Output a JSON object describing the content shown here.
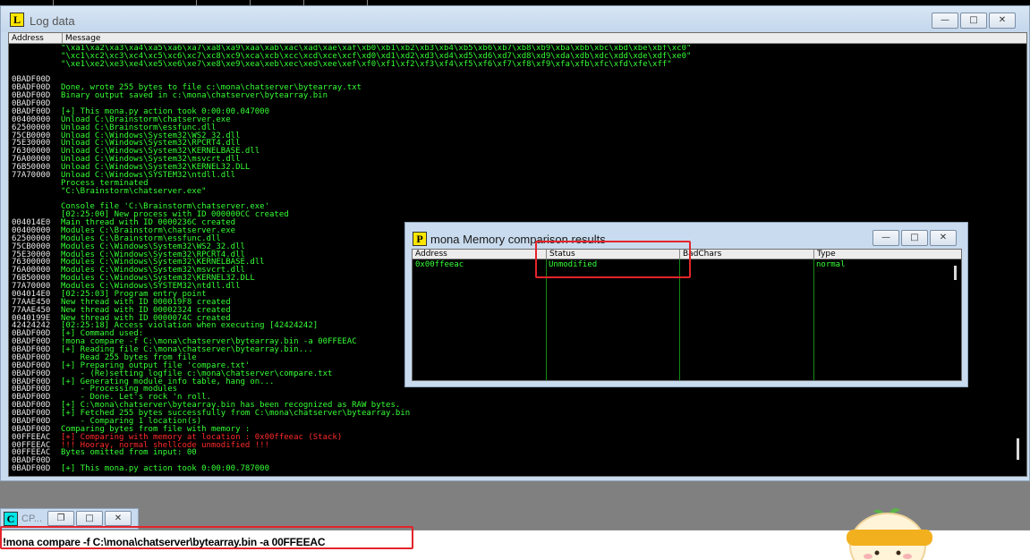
{
  "log_window": {
    "title": "Log data",
    "icon_letter": "L",
    "columns": {
      "address": "Address",
      "message": "Message"
    },
    "lines": [
      {
        "addr": "",
        "msg": "\"\\xa1\\xa2\\xa3\\xa4\\xa5\\xa6\\xa7\\xa8\\xa9\\xaa\\xab\\xac\\xad\\xae\\xaf\\xb0\\xb1\\xb2\\xb3\\xb4\\xb5\\xb6\\xb7\\xb8\\xb9\\xba\\xbb\\xbc\\xbd\\xbe\\xbf\\xc0\""
      },
      {
        "addr": "",
        "msg": "\"\\xc1\\xc2\\xc3\\xc4\\xc5\\xc6\\xc7\\xc8\\xc9\\xca\\xcb\\xcc\\xcd\\xce\\xcf\\xd0\\xd1\\xd2\\xd3\\xd4\\xd5\\xd6\\xd7\\xd8\\xd9\\xda\\xdb\\xdc\\xdd\\xde\\xdf\\xe0\""
      },
      {
        "addr": "",
        "msg": "\"\\xe1\\xe2\\xe3\\xe4\\xe5\\xe6\\xe7\\xe8\\xe9\\xea\\xeb\\xec\\xed\\xee\\xef\\xf0\\xf1\\xf2\\xf3\\xf4\\xf5\\xf6\\xf7\\xf8\\xf9\\xfa\\xfb\\xfc\\xfd\\xfe\\xff\""
      },
      {
        "addr": "",
        "msg": ""
      },
      {
        "addr": "0BADF00D",
        "msg": ""
      },
      {
        "addr": "0BADF00D",
        "msg": "Done, wrote 255 bytes to file c:\\mona\\chatserver\\bytearray.txt"
      },
      {
        "addr": "0BADF00D",
        "msg": "Binary output saved in c:\\mona\\chatserver\\bytearray.bin"
      },
      {
        "addr": "0BADF00D",
        "msg": ""
      },
      {
        "addr": "0BADF00D",
        "msg": "[+] This mona.py action took 0:00:00.047000"
      },
      {
        "addr": "00400000",
        "msg": "Unload C:\\Brainstorm\\chatserver.exe"
      },
      {
        "addr": "62500000",
        "msg": "Unload C:\\Brainstorm\\essfunc.dll"
      },
      {
        "addr": "75CB0000",
        "msg": "Unload C:\\Windows\\System32\\WS2_32.dll"
      },
      {
        "addr": "75E30000",
        "msg": "Unload C:\\Windows\\System32\\RPCRT4.dll"
      },
      {
        "addr": "76300000",
        "msg": "Unload C:\\Windows\\System32\\KERNELBASE.dll"
      },
      {
        "addr": "76A00000",
        "msg": "Unload C:\\Windows\\System32\\msvcrt.dll"
      },
      {
        "addr": "76B50000",
        "msg": "Unload C:\\Windows\\System32\\KERNEL32.DLL"
      },
      {
        "addr": "77A70000",
        "msg": "Unload C:\\Windows\\SYSTEM32\\ntdll.dll"
      },
      {
        "addr": "",
        "msg": "Process terminated"
      },
      {
        "addr": "",
        "msg": "\"C:\\Brainstorm\\chatserver.exe\""
      },
      {
        "addr": "",
        "msg": ""
      },
      {
        "addr": "",
        "msg": "Console file 'C:\\Brainstorm\\chatserver.exe'"
      },
      {
        "addr": "",
        "msg": "[02:25:00] New process with ID 000000CC created"
      },
      {
        "addr": "004014E0",
        "msg": "Main thread with ID 0000236C created"
      },
      {
        "addr": "00400000",
        "msg": "Modules C:\\Brainstorm\\chatserver.exe"
      },
      {
        "addr": "62500000",
        "msg": "Modules C:\\Brainstorm\\essfunc.dll"
      },
      {
        "addr": "75CB0000",
        "msg": "Modules C:\\Windows\\System32\\WS2_32.dll"
      },
      {
        "addr": "75E30000",
        "msg": "Modules C:\\Windows\\System32\\RPCRT4.dll"
      },
      {
        "addr": "76300000",
        "msg": "Modules C:\\Windows\\System32\\KERNELBASE.dll"
      },
      {
        "addr": "76A00000",
        "msg": "Modules C:\\Windows\\System32\\msvcrt.dll"
      },
      {
        "addr": "76B50000",
        "msg": "Modules C:\\Windows\\System32\\KERNEL32.DLL"
      },
      {
        "addr": "77A70000",
        "msg": "Modules C:\\Windows\\SYSTEM32\\ntdll.dll"
      },
      {
        "addr": "004014E0",
        "msg": "[02:25:03] Program entry point"
      },
      {
        "addr": "77AAE450",
        "msg": "New thread with ID 000019F8 created"
      },
      {
        "addr": "77AAE450",
        "msg": "New thread with ID 00002324 created"
      },
      {
        "addr": "0040199E",
        "msg": "New thread with ID 0000074C created"
      },
      {
        "addr": "42424242",
        "msg": "[02:25:18] Access violation when executing [42424242]"
      },
      {
        "addr": "0BADF00D",
        "msg": "[+] Command used:"
      },
      {
        "addr": "0BADF00D",
        "msg": "!mona compare -f C:\\mona\\chatserver\\bytearray.bin -a 00FFEEAC"
      },
      {
        "addr": "0BADF00D",
        "msg": "[+] Reading file C:\\mona\\chatserver\\bytearray.bin..."
      },
      {
        "addr": "0BADF00D",
        "msg": "    Read 255 bytes from file"
      },
      {
        "addr": "0BADF00D",
        "msg": "[+] Preparing output file 'compare.txt'"
      },
      {
        "addr": "0BADF00D",
        "msg": "    - (Re)setting logfile c:\\mona\\chatserver\\compare.txt"
      },
      {
        "addr": "0BADF00D",
        "msg": "[+] Generating module info table, hang on..."
      },
      {
        "addr": "0BADF00D",
        "msg": "    - Processing modules"
      },
      {
        "addr": "0BADF00D",
        "msg": "    - Done. Let's rock 'n roll."
      },
      {
        "addr": "0BADF00D",
        "msg": "[+] C:\\mona\\chatserver\\bytearray.bin has been recognized as RAW bytes."
      },
      {
        "addr": "0BADF00D",
        "msg": "[+] Fetched 255 bytes successfully from C:\\mona\\chatserver\\bytearray.bin"
      },
      {
        "addr": "0BADF00D",
        "msg": "    - Comparing 1 location(s)"
      },
      {
        "addr": "0BADF00D",
        "msg": "Comparing bytes from file with memory :"
      },
      {
        "addr": "00FFEEAC",
        "msg": "[+] Comparing with memory at location : 0x00ffeeac (Stack)",
        "red": true
      },
      {
        "addr": "00FFEEAC",
        "msg": "!!! Hooray, normal shellcode unmodified !!!",
        "red": true
      },
      {
        "addr": "00FFEEAC",
        "msg": "Bytes omitted from input: 00"
      },
      {
        "addr": "0BADF00D",
        "msg": ""
      },
      {
        "addr": "0BADF00D",
        "msg": "[+] This mona.py action took 0:00:00.787000"
      }
    ]
  },
  "mona_window": {
    "title": "mona Memory comparison results",
    "icon_letter": "P",
    "columns": {
      "address": "Address",
      "status": "Status",
      "badchars": "BadChars",
      "type": "Type"
    },
    "rows": [
      {
        "address": "0x00ffeeac",
        "status": "Unmodified",
        "badchars": "",
        "type": "normal"
      }
    ]
  },
  "cpu_window": {
    "title": "CP...",
    "icon_letter": "C"
  },
  "command_bar": {
    "value": "!mona compare -f C:\\mona\\chatserver\\bytearray.bin -a 00FFEEAC"
  },
  "window_buttons": {
    "minimize": "—",
    "maximize": "□",
    "restore": "❐",
    "close": "✕"
  },
  "colors": {
    "log_text": "#35ff35",
    "error_text": "#ff2a2a",
    "highlight": "#e3242b",
    "console_bg": "#000000"
  },
  "icons": [
    "log-app-icon",
    "mona-app-icon",
    "cpu-app-icon",
    "minimize-icon",
    "maximize-icon",
    "restore-icon",
    "close-icon"
  ]
}
